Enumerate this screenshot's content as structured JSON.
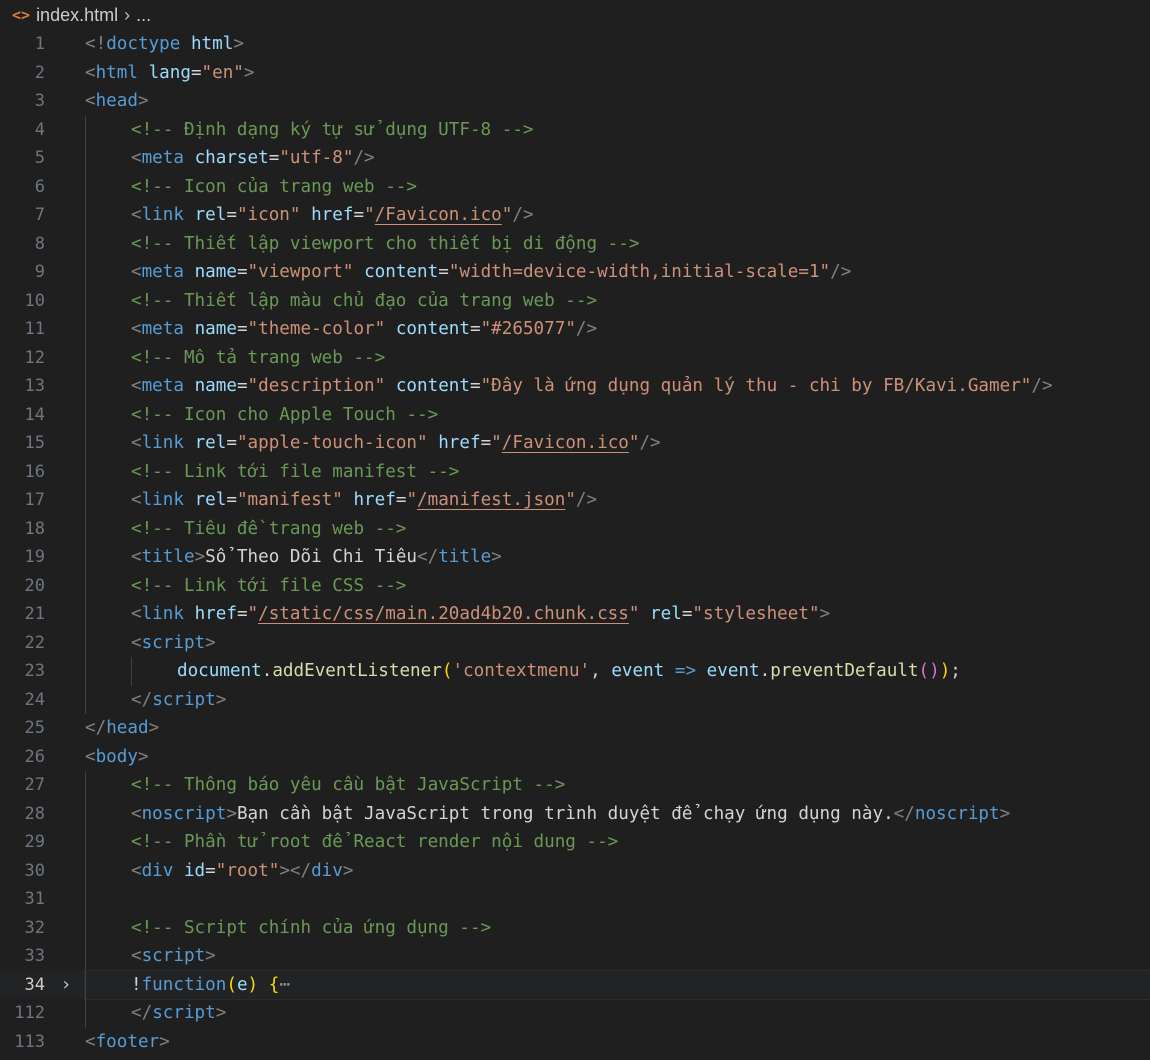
{
  "breadcrumb": {
    "file_icon": "<>",
    "file_name": "index.html",
    "separator": "›",
    "more": "..."
  },
  "current_line": "34",
  "lines": [
    {
      "n": "1",
      "indent": 0,
      "tokens": [
        [
          "brk",
          "<!"
        ],
        [
          "tag",
          "doctype"
        ],
        [
          "txt",
          " "
        ],
        [
          "attr",
          "html"
        ],
        [
          "brk",
          ">"
        ]
      ]
    },
    {
      "n": "2",
      "indent": 0,
      "tokens": [
        [
          "brk",
          "<"
        ],
        [
          "tag",
          "html"
        ],
        [
          "txt",
          " "
        ],
        [
          "attr",
          "lang"
        ],
        [
          "txt",
          "="
        ],
        [
          "str",
          "\"en\""
        ],
        [
          "brk",
          ">"
        ]
      ]
    },
    {
      "n": "3",
      "indent": 0,
      "tokens": [
        [
          "brk",
          "<"
        ],
        [
          "tag",
          "head"
        ],
        [
          "brk",
          ">"
        ]
      ]
    },
    {
      "n": "4",
      "indent": 1,
      "tokens": [
        [
          "com",
          "<!-- Định dạng ký tự sử dụng UTF-8 -->"
        ]
      ]
    },
    {
      "n": "5",
      "indent": 1,
      "tokens": [
        [
          "brk",
          "<"
        ],
        [
          "tag",
          "meta"
        ],
        [
          "txt",
          " "
        ],
        [
          "attr",
          "charset"
        ],
        [
          "txt",
          "="
        ],
        [
          "str",
          "\"utf-8\""
        ],
        [
          "brk",
          "/>"
        ]
      ]
    },
    {
      "n": "6",
      "indent": 1,
      "tokens": [
        [
          "com",
          "<!-- Icon của trang web -->"
        ]
      ]
    },
    {
      "n": "7",
      "indent": 1,
      "tokens": [
        [
          "brk",
          "<"
        ],
        [
          "tag",
          "link"
        ],
        [
          "txt",
          " "
        ],
        [
          "attr",
          "rel"
        ],
        [
          "txt",
          "="
        ],
        [
          "str",
          "\"icon\""
        ],
        [
          "txt",
          " "
        ],
        [
          "attr",
          "href"
        ],
        [
          "txt",
          "="
        ],
        [
          "str",
          "\""
        ],
        [
          "link",
          "/Favicon.ico"
        ],
        [
          "str",
          "\""
        ],
        [
          "brk",
          "/>"
        ]
      ]
    },
    {
      "n": "8",
      "indent": 1,
      "tokens": [
        [
          "com",
          "<!-- Thiết lập viewport cho thiết bị di động -->"
        ]
      ]
    },
    {
      "n": "9",
      "indent": 1,
      "tokens": [
        [
          "brk",
          "<"
        ],
        [
          "tag",
          "meta"
        ],
        [
          "txt",
          " "
        ],
        [
          "attr",
          "name"
        ],
        [
          "txt",
          "="
        ],
        [
          "str",
          "\"viewport\""
        ],
        [
          "txt",
          " "
        ],
        [
          "attr",
          "content"
        ],
        [
          "txt",
          "="
        ],
        [
          "str",
          "\"width=device-width,initial-scale=1\""
        ],
        [
          "brk",
          "/>"
        ]
      ]
    },
    {
      "n": "10",
      "indent": 1,
      "tokens": [
        [
          "com",
          "<!-- Thiết lập màu chủ đạo của trang web -->"
        ]
      ]
    },
    {
      "n": "11",
      "indent": 1,
      "tokens": [
        [
          "brk",
          "<"
        ],
        [
          "tag",
          "meta"
        ],
        [
          "txt",
          " "
        ],
        [
          "attr",
          "name"
        ],
        [
          "txt",
          "="
        ],
        [
          "str",
          "\"theme-color\""
        ],
        [
          "txt",
          " "
        ],
        [
          "attr",
          "content"
        ],
        [
          "txt",
          "="
        ],
        [
          "str",
          "\"#265077\""
        ],
        [
          "brk",
          "/>"
        ]
      ]
    },
    {
      "n": "12",
      "indent": 1,
      "tokens": [
        [
          "com",
          "<!-- Mô tả trang web -->"
        ]
      ]
    },
    {
      "n": "13",
      "indent": 1,
      "tokens": [
        [
          "brk",
          "<"
        ],
        [
          "tag",
          "meta"
        ],
        [
          "txt",
          " "
        ],
        [
          "attr",
          "name"
        ],
        [
          "txt",
          "="
        ],
        [
          "str",
          "\"description\""
        ],
        [
          "txt",
          " "
        ],
        [
          "attr",
          "content"
        ],
        [
          "txt",
          "="
        ],
        [
          "str",
          "\"Đây là ứng dụng quản lý thu - chi by FB/Kavi.Gamer\""
        ],
        [
          "brk",
          "/>"
        ]
      ]
    },
    {
      "n": "14",
      "indent": 1,
      "tokens": [
        [
          "com",
          "<!-- Icon cho Apple Touch -->"
        ]
      ]
    },
    {
      "n": "15",
      "indent": 1,
      "tokens": [
        [
          "brk",
          "<"
        ],
        [
          "tag",
          "link"
        ],
        [
          "txt",
          " "
        ],
        [
          "attr",
          "rel"
        ],
        [
          "txt",
          "="
        ],
        [
          "str",
          "\"apple-touch-icon\""
        ],
        [
          "txt",
          " "
        ],
        [
          "attr",
          "href"
        ],
        [
          "txt",
          "="
        ],
        [
          "str",
          "\""
        ],
        [
          "link",
          "/Favicon.ico"
        ],
        [
          "str",
          "\""
        ],
        [
          "brk",
          "/>"
        ]
      ]
    },
    {
      "n": "16",
      "indent": 1,
      "tokens": [
        [
          "com",
          "<!-- Link tới file manifest -->"
        ]
      ]
    },
    {
      "n": "17",
      "indent": 1,
      "tokens": [
        [
          "brk",
          "<"
        ],
        [
          "tag",
          "link"
        ],
        [
          "txt",
          " "
        ],
        [
          "attr",
          "rel"
        ],
        [
          "txt",
          "="
        ],
        [
          "str",
          "\"manifest\""
        ],
        [
          "txt",
          " "
        ],
        [
          "attr",
          "href"
        ],
        [
          "txt",
          "="
        ],
        [
          "str",
          "\""
        ],
        [
          "link",
          "/manifest.json"
        ],
        [
          "str",
          "\""
        ],
        [
          "brk",
          "/>"
        ]
      ]
    },
    {
      "n": "18",
      "indent": 1,
      "tokens": [
        [
          "com",
          "<!-- Tiêu đề trang web -->"
        ]
      ]
    },
    {
      "n": "19",
      "indent": 1,
      "tokens": [
        [
          "brk",
          "<"
        ],
        [
          "tag",
          "title"
        ],
        [
          "brk",
          ">"
        ],
        [
          "txt",
          "Sổ Theo Dõi Chi Tiêu"
        ],
        [
          "brk",
          "</"
        ],
        [
          "tag",
          "title"
        ],
        [
          "brk",
          ">"
        ]
      ]
    },
    {
      "n": "20",
      "indent": 1,
      "tokens": [
        [
          "com",
          "<!-- Link tới file CSS -->"
        ]
      ]
    },
    {
      "n": "21",
      "indent": 1,
      "tokens": [
        [
          "brk",
          "<"
        ],
        [
          "tag",
          "link"
        ],
        [
          "txt",
          " "
        ],
        [
          "attr",
          "href"
        ],
        [
          "txt",
          "="
        ],
        [
          "str",
          "\""
        ],
        [
          "link",
          "/static/css/main.20ad4b20.chunk.css"
        ],
        [
          "str",
          "\""
        ],
        [
          "txt",
          " "
        ],
        [
          "attr",
          "rel"
        ],
        [
          "txt",
          "="
        ],
        [
          "str",
          "\"stylesheet\""
        ],
        [
          "brk",
          ">"
        ]
      ]
    },
    {
      "n": "22",
      "indent": 1,
      "tokens": [
        [
          "brk",
          "<"
        ],
        [
          "tag",
          "script"
        ],
        [
          "brk",
          ">"
        ]
      ]
    },
    {
      "n": "23",
      "indent": 2,
      "tokens": [
        [
          "var",
          "document"
        ],
        [
          "op",
          "."
        ],
        [
          "fn",
          "addEventListener"
        ],
        [
          "p1",
          "("
        ],
        [
          "str",
          "'contextmenu'"
        ],
        [
          "op",
          ", "
        ],
        [
          "var",
          "event"
        ],
        [
          "op",
          " "
        ],
        [
          "kw",
          "=>"
        ],
        [
          "op",
          " "
        ],
        [
          "var",
          "event"
        ],
        [
          "op",
          "."
        ],
        [
          "fn",
          "preventDefault"
        ],
        [
          "p2",
          "()"
        ],
        [
          "p1",
          ")"
        ],
        [
          "op",
          ";"
        ]
      ]
    },
    {
      "n": "24",
      "indent": 1,
      "tokens": [
        [
          "brk",
          "</"
        ],
        [
          "tag",
          "script"
        ],
        [
          "brk",
          ">"
        ]
      ]
    },
    {
      "n": "25",
      "indent": 0,
      "tokens": [
        [
          "brk",
          "</"
        ],
        [
          "tag",
          "head"
        ],
        [
          "brk",
          ">"
        ]
      ]
    },
    {
      "n": "26",
      "indent": 0,
      "tokens": [
        [
          "brk",
          "<"
        ],
        [
          "tag",
          "body"
        ],
        [
          "brk",
          ">"
        ]
      ]
    },
    {
      "n": "27",
      "indent": 1,
      "tokens": [
        [
          "com",
          "<!-- Thông báo yêu cầu bật JavaScript -->"
        ]
      ]
    },
    {
      "n": "28",
      "indent": 1,
      "tokens": [
        [
          "brk",
          "<"
        ],
        [
          "tag",
          "noscript"
        ],
        [
          "brk",
          ">"
        ],
        [
          "txt",
          "Bạn cần bật JavaScript trong trình duyệt để chạy ứng dụng này."
        ],
        [
          "brk",
          "</"
        ],
        [
          "tag",
          "noscript"
        ],
        [
          "brk",
          ">"
        ]
      ]
    },
    {
      "n": "29",
      "indent": 1,
      "tokens": [
        [
          "com",
          "<!-- Phần tử root để React render nội dung -->"
        ]
      ]
    },
    {
      "n": "30",
      "indent": 1,
      "tokens": [
        [
          "brk",
          "<"
        ],
        [
          "tag",
          "div"
        ],
        [
          "txt",
          " "
        ],
        [
          "attr",
          "id"
        ],
        [
          "txt",
          "="
        ],
        [
          "str",
          "\"root\""
        ],
        [
          "brk",
          "></"
        ],
        [
          "tag",
          "div"
        ],
        [
          "brk",
          ">"
        ]
      ]
    },
    {
      "n": "31",
      "indent": 1,
      "tokens": []
    },
    {
      "n": "32",
      "indent": 1,
      "tokens": [
        [
          "com",
          "<!-- Script chính của ứng dụng -->"
        ]
      ]
    },
    {
      "n": "33",
      "indent": 1,
      "tokens": [
        [
          "brk",
          "<"
        ],
        [
          "tag",
          "script"
        ],
        [
          "brk",
          ">"
        ]
      ]
    },
    {
      "n": "34",
      "indent": 1,
      "fold": "›",
      "tokens": [
        [
          "op",
          "!"
        ],
        [
          "kw",
          "function"
        ],
        [
          "p1",
          "("
        ],
        [
          "var",
          "e"
        ],
        [
          "p1",
          ")"
        ],
        [
          "op",
          " "
        ],
        [
          "p1",
          "{"
        ],
        [
          "ell",
          "⋯"
        ]
      ]
    },
    {
      "n": "112",
      "indent": 1,
      "tokens": [
        [
          "brk",
          "</"
        ],
        [
          "tag",
          "script"
        ],
        [
          "brk",
          ">"
        ]
      ]
    },
    {
      "n": "113",
      "indent": 0,
      "tokens": [
        [
          "brk",
          "<"
        ],
        [
          "tag",
          "footer"
        ],
        [
          "brk",
          ">"
        ]
      ]
    }
  ]
}
